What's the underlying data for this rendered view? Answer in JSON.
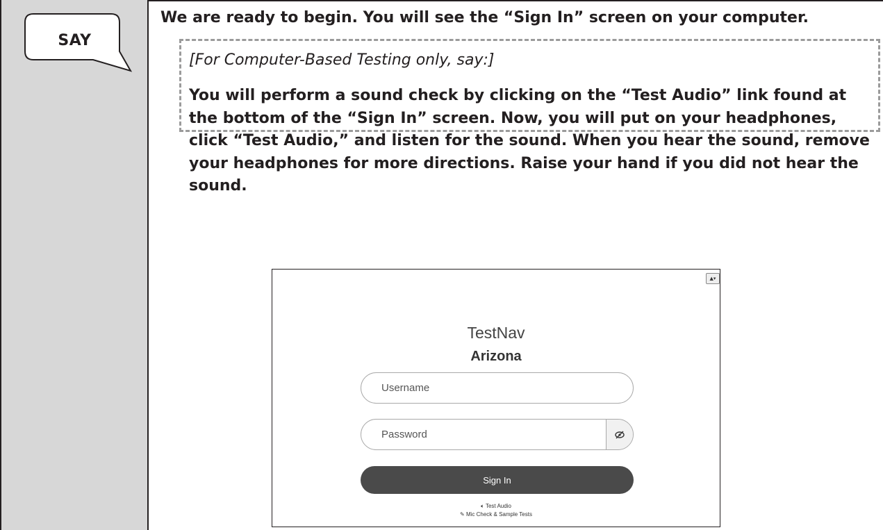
{
  "say_label": "SAY",
  "intro_text": "We are ready to begin. You will see the “Sign In” screen on your computer.",
  "cbt_note": "[For Computer-Based Testing only, say:]",
  "instructions": "You will perform a sound check by clicking on the “Test Audio” link found at the bottom of the “Sign In” screen. Now, you will put on your headphones, click “Test Audio,” and listen for the sound. When you hear the sound, remove your headphones for more directions. Raise your hand if you did not hear the sound.",
  "screenshot": {
    "brand": "TestNav",
    "state": "Arizona",
    "username_placeholder": "Username",
    "password_placeholder": "Password",
    "sign_in_label": "Sign In",
    "test_audio_label": "Test Audio",
    "mic_check_label": "Mic Check & Sample Tests",
    "account_icon": "user-menu-icon",
    "eye_icon": "eye-slash-icon"
  }
}
